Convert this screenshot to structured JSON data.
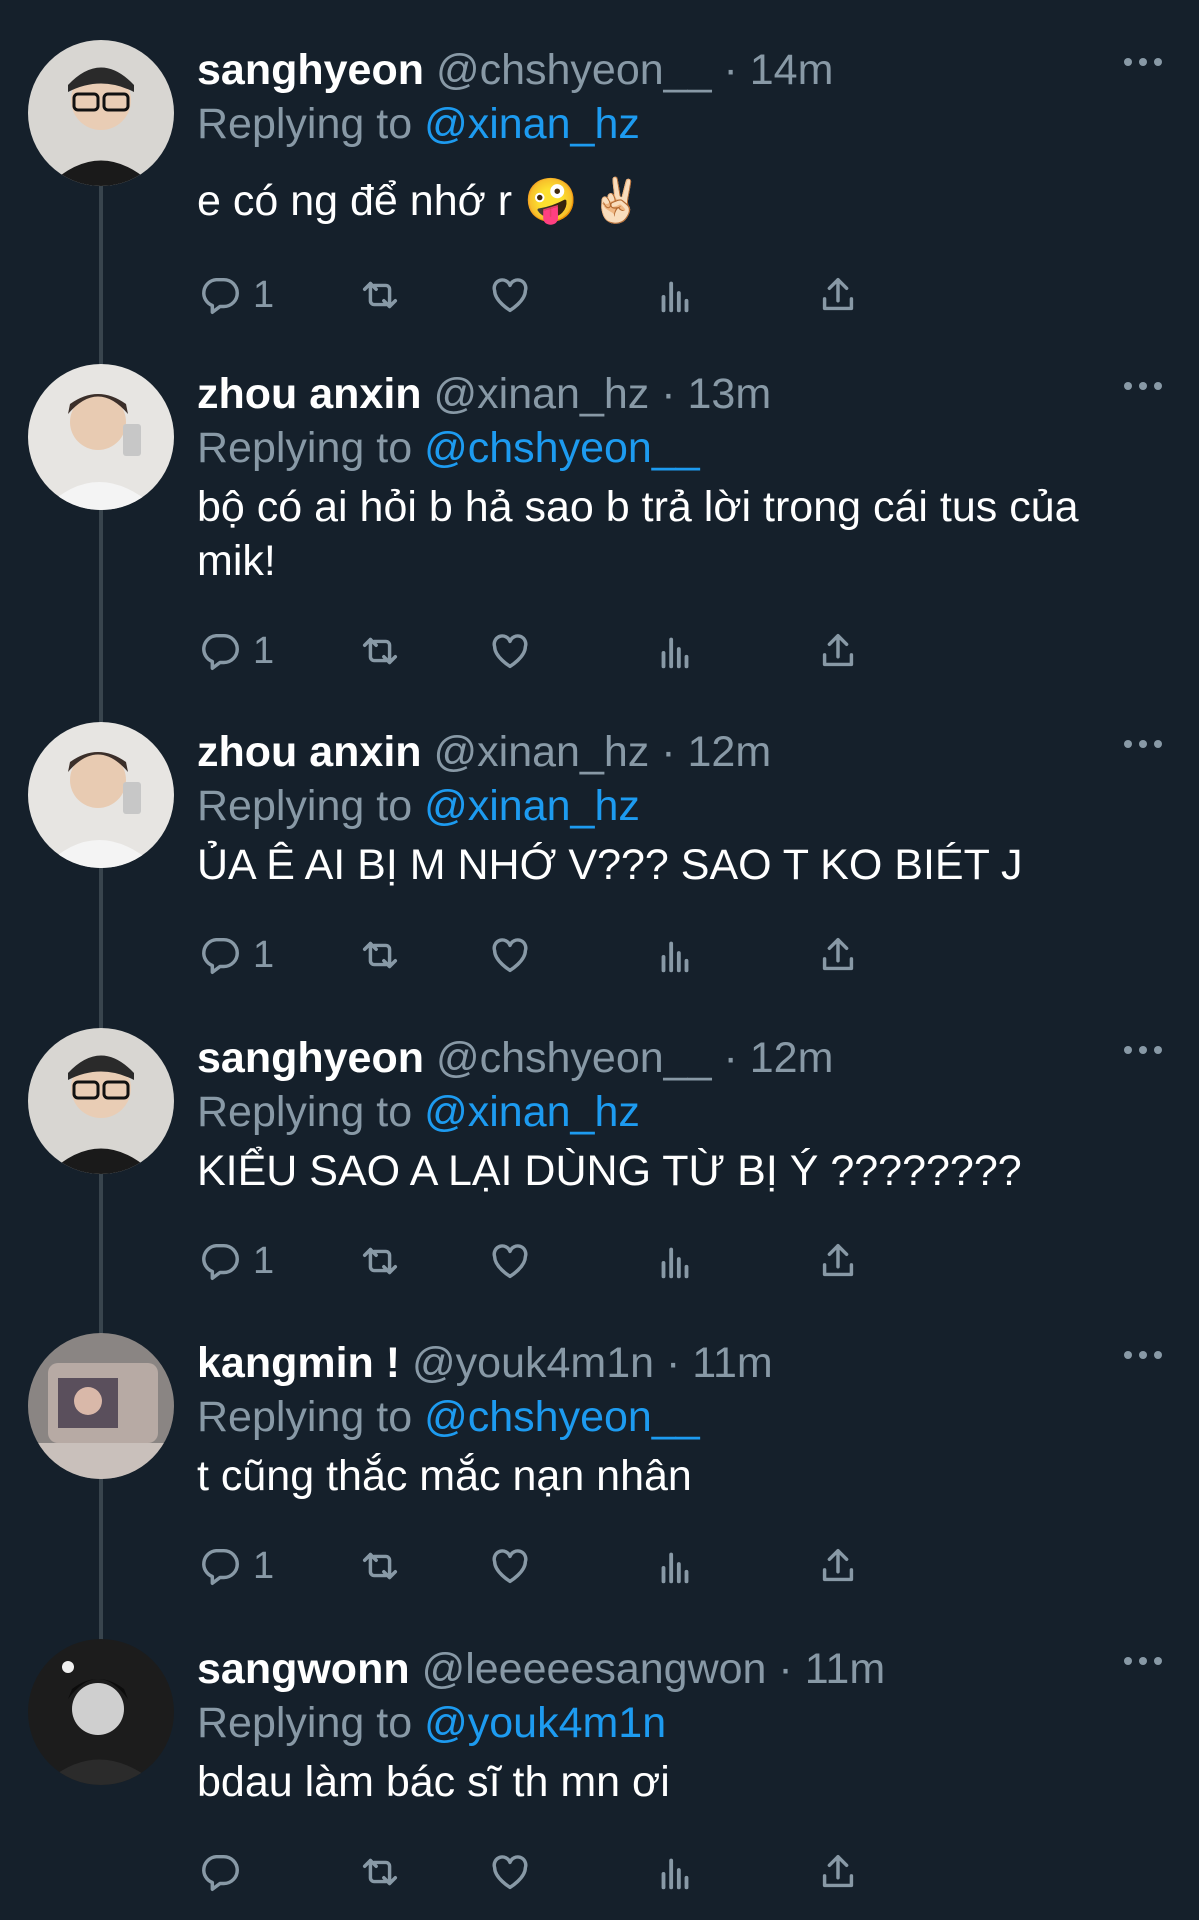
{
  "reply_prefix": "Replying to",
  "tweets": [
    {
      "name": "sanghyeon",
      "handle": "@chshyeon__",
      "time": "· 14m",
      "replying_to": "@xinan_hz",
      "text": "e có ng để nhớ r 🤪 ✌🏻",
      "reply_count": "1"
    },
    {
      "name": "zhou anxin",
      "handle": "@xinan_hz",
      "time": "· 13m",
      "replying_to": "@chshyeon__",
      "text": "bộ có ai hỏi b hả sao b trả lời trong cái tus của mik!",
      "reply_count": "1"
    },
    {
      "name": "zhou anxin",
      "handle": "@xinan_hz",
      "time": "· 12m",
      "replying_to": "@xinan_hz",
      "text": "ỦA Ê AI BỊ M NHỚ V??? SAO T KO BIÉT J",
      "reply_count": "1"
    },
    {
      "name": "sanghyeon",
      "handle": "@chshyeon__",
      "time": "· 12m",
      "replying_to": "@xinan_hz",
      "text": "KIỂU SAO A LẠI DÙNG TỪ BỊ Ý ????????",
      "reply_count": "1"
    },
    {
      "name": "kangmin !",
      "handle": "@youk4m1n",
      "time": "· 11m",
      "replying_to": "@chshyeon__",
      "text": "t cũng thắc mắc nạn nhân",
      "reply_count": "1"
    },
    {
      "name": "sangwonn",
      "handle": "@leeeeesangwon",
      "time": "· 11m",
      "replying_to": "@youk4m1n",
      "text": "bdau làm bác sĩ th mn ơi",
      "reply_count": ""
    }
  ],
  "colors": {
    "background": "#15202b",
    "muted": "#8899a6",
    "link": "#1d9bf0",
    "thread_line": "#38444d"
  },
  "icons": [
    "reply-icon",
    "retweet-icon",
    "like-icon",
    "analytics-icon",
    "share-icon",
    "more-icon"
  ]
}
